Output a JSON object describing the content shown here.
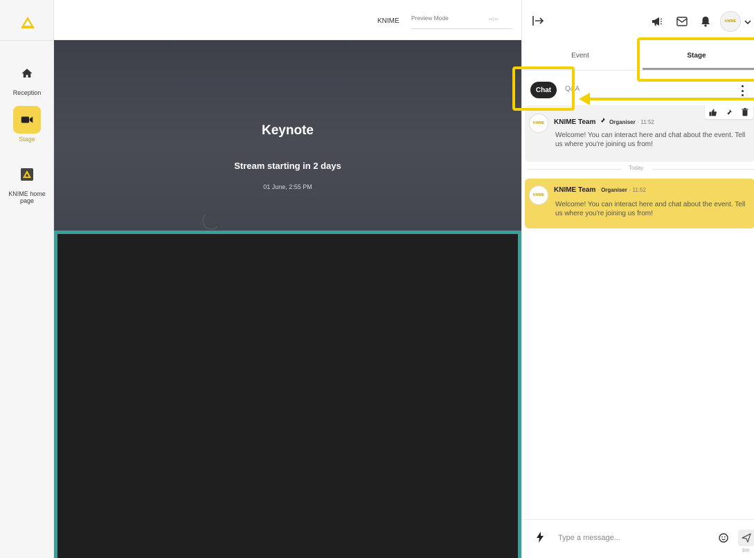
{
  "app": {
    "brand": "KNIME",
    "preview_mode": "Preview Mode",
    "preview_time": "--:--"
  },
  "leftnav": {
    "items": [
      {
        "label": "Reception",
        "icon": "home-icon"
      },
      {
        "label": "Stage",
        "icon": "video-camera-icon",
        "active": true
      },
      {
        "label": "KNIME home page",
        "icon": "knime-logo-icon"
      }
    ]
  },
  "stage": {
    "title": "Keynote",
    "status": "Stream starting in 2 days",
    "datetime": "01 June, 2:55 PM"
  },
  "right_panel": {
    "avatar_text": "KNIME",
    "tabs": [
      {
        "label": "Event"
      },
      {
        "label": "Stage",
        "active": true
      }
    ],
    "subtabs": {
      "chat": "Chat",
      "qa": "Q&A"
    },
    "messages": [
      {
        "author": "KNIME Team",
        "role": "Organiser",
        "time": "11:52",
        "pinned": true,
        "text": "Welcome! You can interact here and chat about the event. Tell us where you're joining us from!"
      },
      {
        "author": "KNIME Team",
        "role": "Organiser",
        "time": "11:52",
        "pinned": false,
        "text": "Welcome! You can interact here and chat about the event. Tell us where you're joining us from!"
      }
    ],
    "day_divider": "Today",
    "composer": {
      "placeholder": "Type a message...",
      "char_limit": "500"
    }
  },
  "colors": {
    "accent_yellow": "#f5d000",
    "stage_bg": "#44464f",
    "video_border": "#3a9f96",
    "message_highlight": "#f5d860"
  }
}
